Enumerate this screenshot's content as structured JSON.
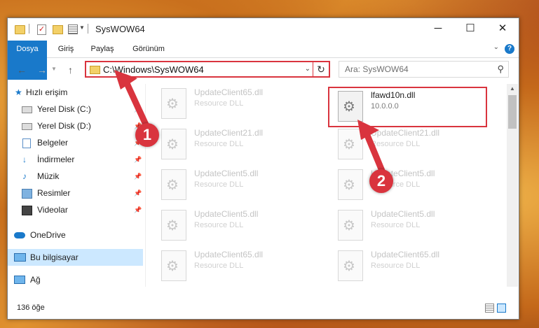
{
  "window": {
    "title": "SysWOW64"
  },
  "ribbon": {
    "tabs": [
      "Dosya",
      "Giriş",
      "Paylaş",
      "Görünüm"
    ],
    "help": "?"
  },
  "address": {
    "path": "C:\\Windows\\SysWOW64"
  },
  "search": {
    "placeholder": "Ara: SysWOW64"
  },
  "sidebar": {
    "items": [
      {
        "label": "Hızlı erişim",
        "icon": "star-icon"
      },
      {
        "label": "Yerel Disk (C:)",
        "icon": "drive-icon",
        "pinned": true
      },
      {
        "label": "Yerel Disk (D:)",
        "icon": "drive-icon",
        "pinned": true
      },
      {
        "label": "Belgeler",
        "icon": "documents-icon",
        "pinned": true
      },
      {
        "label": "İndirmeler",
        "icon": "download-icon",
        "pinned": true
      },
      {
        "label": "Müzik",
        "icon": "music-icon",
        "pinned": true
      },
      {
        "label": "Resimler",
        "icon": "pictures-icon",
        "pinned": true
      },
      {
        "label": "Videolar",
        "icon": "videos-icon",
        "pinned": true
      },
      {
        "label": "OneDrive",
        "icon": "cloud-icon"
      },
      {
        "label": "Bu bilgisayar",
        "icon": "computer-icon",
        "selected": true
      },
      {
        "label": "Ağ",
        "icon": "network-icon"
      }
    ]
  },
  "files": {
    "left": [
      {
        "name": "UpdateClient65.dll",
        "type": "Resource DLL"
      },
      {
        "name": "UpdateClient21.dll",
        "type": "Resource DLL"
      },
      {
        "name": "UpdateClient5.dll",
        "type": "Resource DLL"
      },
      {
        "name": "UpdateClient5.dll",
        "type": "Resource DLL"
      },
      {
        "name": "UpdateClient65.dll",
        "type": "Resource DLL"
      }
    ],
    "right": [
      {
        "name": "lfawd10n.dll",
        "type": "10.0.0.0",
        "highlighted": true
      },
      {
        "name": "UpdateClient21.dll",
        "type": "Resource DLL"
      },
      {
        "name": "UpdateClient5.dll",
        "type": "Resource DLL"
      },
      {
        "name": "UpdateClient5.dll",
        "type": "Resource DLL"
      },
      {
        "name": "UpdateClient65.dll",
        "type": "Resource DLL"
      }
    ]
  },
  "status": {
    "count": "136 öğe"
  },
  "annotations": {
    "step1": "1",
    "step2": "2",
    "color": "#d9343e"
  }
}
